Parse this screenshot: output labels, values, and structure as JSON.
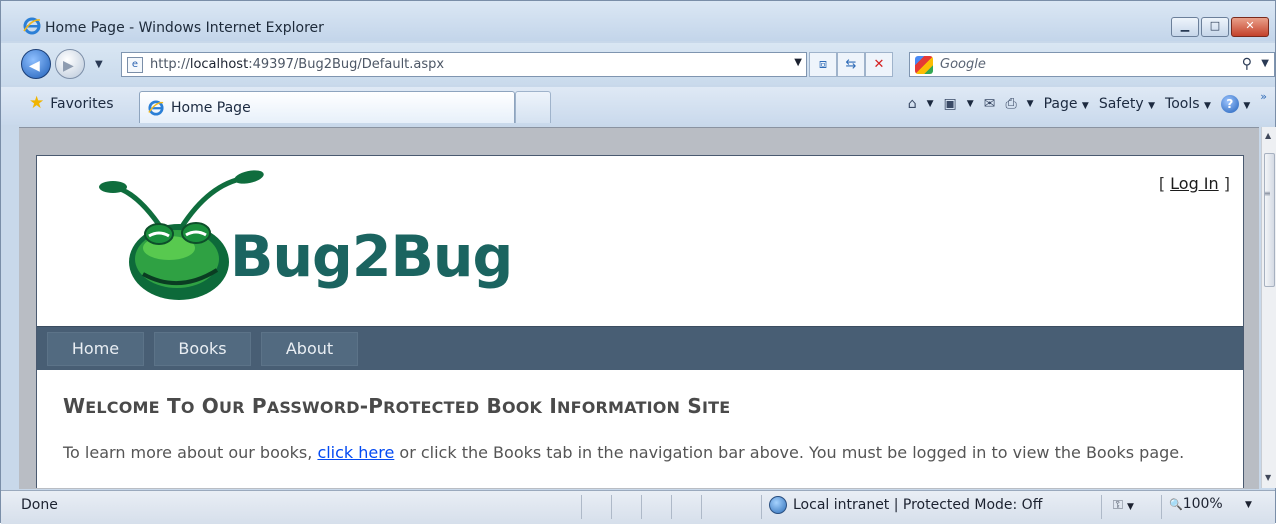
{
  "window": {
    "title": "Home Page - Windows Internet Explorer",
    "minimize_glyph": "▁",
    "maximize_glyph": "□",
    "close_glyph": "✕"
  },
  "address_bar": {
    "url_prefix": "http://",
    "url_host": "localhost",
    "url_rest": ":49397/Bug2Bug/Default.aspx",
    "dropdown_glyph": "▼"
  },
  "address_icons": [
    "compatibility-view-icon",
    "refresh-icon",
    "stop-icon"
  ],
  "search": {
    "placeholder": "Google",
    "search_glyph": "⚲",
    "dropdown_glyph": "▼"
  },
  "toolbar": {
    "favorites_label": "Favorites",
    "tab_title": "Home Page",
    "page_menu": "Page",
    "safety_menu": "Safety",
    "tools_menu": "Tools",
    "help_glyph": "?",
    "chevron": "»",
    "caret": "▼"
  },
  "site": {
    "brand_name": "Bug2Bug",
    "login_open": "[ ",
    "login_label": "Log In",
    "login_close": " ]",
    "nav": [
      {
        "label": "Home"
      },
      {
        "label": "Books"
      },
      {
        "label": "About"
      }
    ],
    "heading": "Welcome to Our Password-Protected Book Information Site",
    "body_before": "To learn more about our books, ",
    "body_link": "click here",
    "body_after": " or click the Books tab in the navigation bar above. You must be logged in to view the Books page."
  },
  "status_bar": {
    "status": "Done",
    "zone": "Local intranet | Protected Mode: Off",
    "zoom": "100%",
    "zoom_glyph": "🔍",
    "caret": "▼"
  },
  "colors": {
    "navbar": "#485e74",
    "nav_item": "#526a80",
    "brand_green": "#1b6460",
    "link_blue": "#034af3"
  }
}
